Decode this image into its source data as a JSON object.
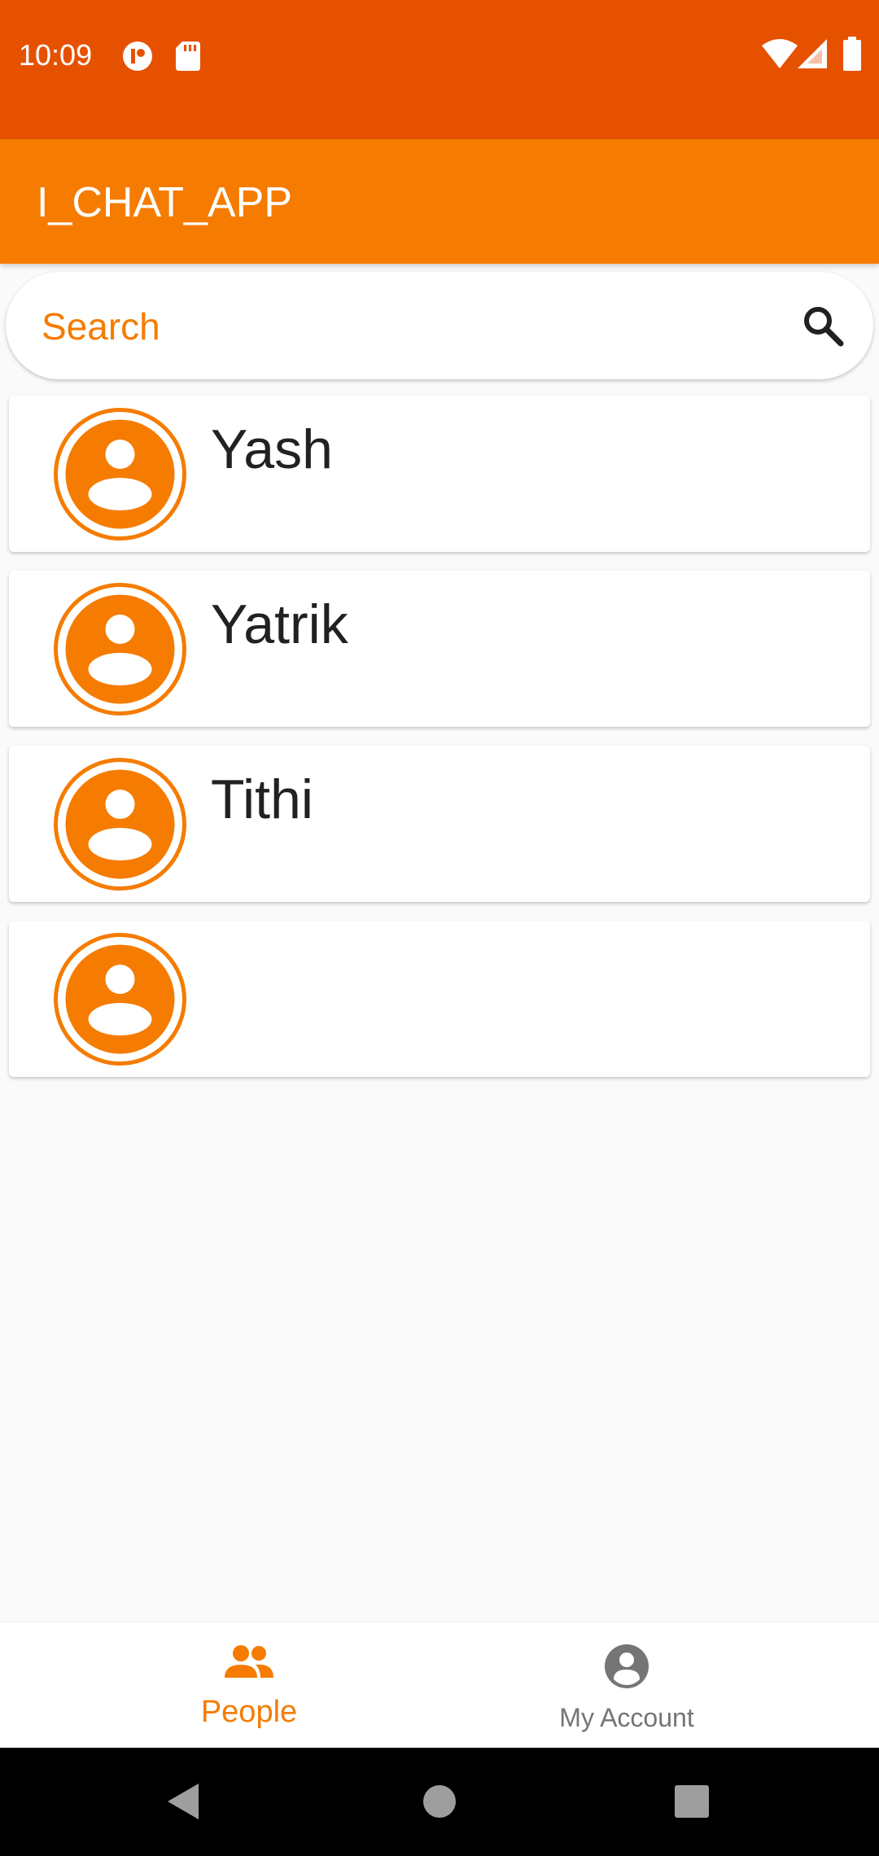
{
  "status_bar": {
    "time": "10:09"
  },
  "app_bar": {
    "title": "I_CHAT_APP"
  },
  "search": {
    "placeholder": "Search"
  },
  "people": [
    {
      "name": "Yash"
    },
    {
      "name": "Yatrik"
    },
    {
      "name": "Tithi"
    },
    {
      "name": ""
    }
  ],
  "bottom_nav": {
    "people_label": "People",
    "account_label": "My Account",
    "active_color": "#f57c00",
    "inactive_color": "#757575"
  },
  "colors": {
    "status_bar": "#e65100",
    "primary": "#f57c00",
    "background": "#fafafa"
  }
}
